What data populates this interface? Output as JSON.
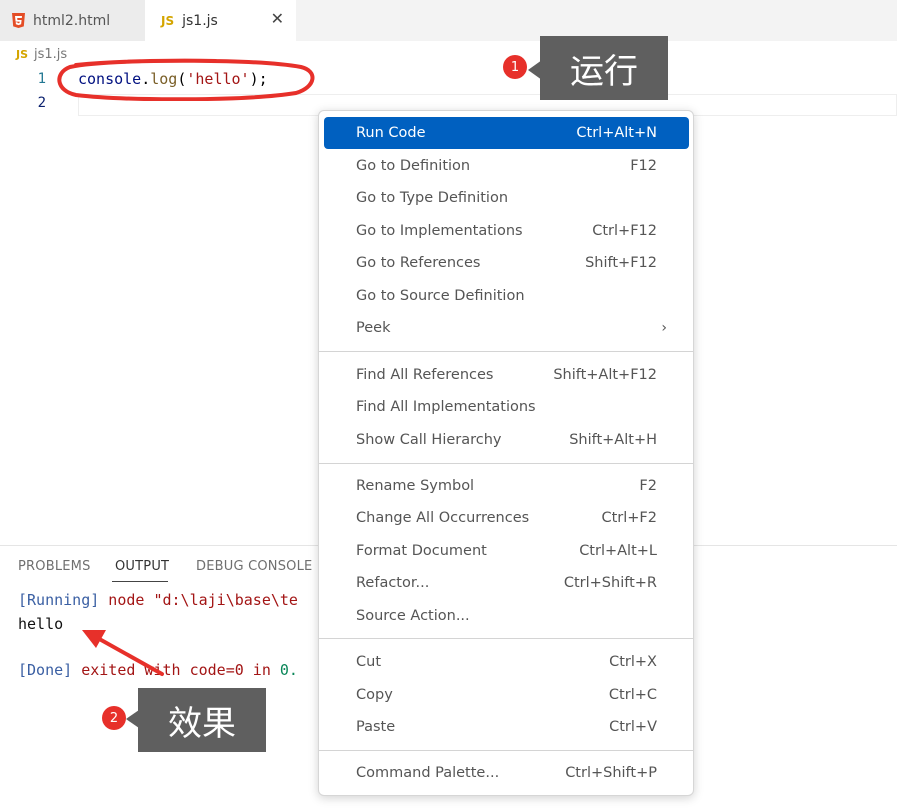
{
  "tabs": [
    {
      "label": "html2.html",
      "icon": "html5-icon"
    },
    {
      "label": "js1.js",
      "icon": "js-icon",
      "icon_text": "JS"
    }
  ],
  "breadcrumb": {
    "icon_text": "JS",
    "file": "js1.js"
  },
  "editor": {
    "line_numbers": [
      "1",
      "2"
    ],
    "code": {
      "ident": "console",
      "dot": ".",
      "fn": "log",
      "open": "(",
      "str": "'hello'",
      "close": ");"
    }
  },
  "annotations": {
    "badge1": "1",
    "label1": "运行",
    "badge2": "2",
    "label2": "效果",
    "highlight_color": "#e7302a"
  },
  "panel": {
    "tabs": [
      "PROBLEMS",
      "OUTPUT",
      "DEBUG CONSOLE"
    ],
    "active_tab": "OUTPUT",
    "output": {
      "running_tag": "[Running]",
      "running_cmd": " node \"d:\\laji\\base\\te",
      "hello": "hello",
      "done_tag": "[Done]",
      "done_text": " exited with code=0 in ",
      "done_num": "0."
    }
  },
  "context_menu": {
    "items": [
      {
        "label": "Run Code",
        "key": "Ctrl+Alt+N"
      },
      {
        "label": "Go to Definition",
        "key": "F12"
      },
      {
        "label": "Go to Type Definition",
        "key": ""
      },
      {
        "label": "Go to Implementations",
        "key": "Ctrl+F12"
      },
      {
        "label": "Go to References",
        "key": "Shift+F12"
      },
      {
        "label": "Go to Source Definition",
        "key": ""
      },
      {
        "label": "Peek",
        "key": ""
      },
      {
        "label": "Find All References",
        "key": "Shift+Alt+F12"
      },
      {
        "label": "Find All Implementations",
        "key": ""
      },
      {
        "label": "Show Call Hierarchy",
        "key": "Shift+Alt+H"
      },
      {
        "label": "Rename Symbol",
        "key": "F2"
      },
      {
        "label": "Change All Occurrences",
        "key": "Ctrl+F2"
      },
      {
        "label": "Format Document",
        "key": "Ctrl+Alt+L"
      },
      {
        "label": "Refactor...",
        "key": "Ctrl+Shift+R"
      },
      {
        "label": "Source Action...",
        "key": ""
      },
      {
        "label": "Cut",
        "key": "Ctrl+X"
      },
      {
        "label": "Copy",
        "key": "Ctrl+C"
      },
      {
        "label": "Paste",
        "key": "Ctrl+V"
      },
      {
        "label": "Command Palette...",
        "key": "Ctrl+Shift+P"
      }
    ],
    "selected_color": "#0060c0"
  }
}
